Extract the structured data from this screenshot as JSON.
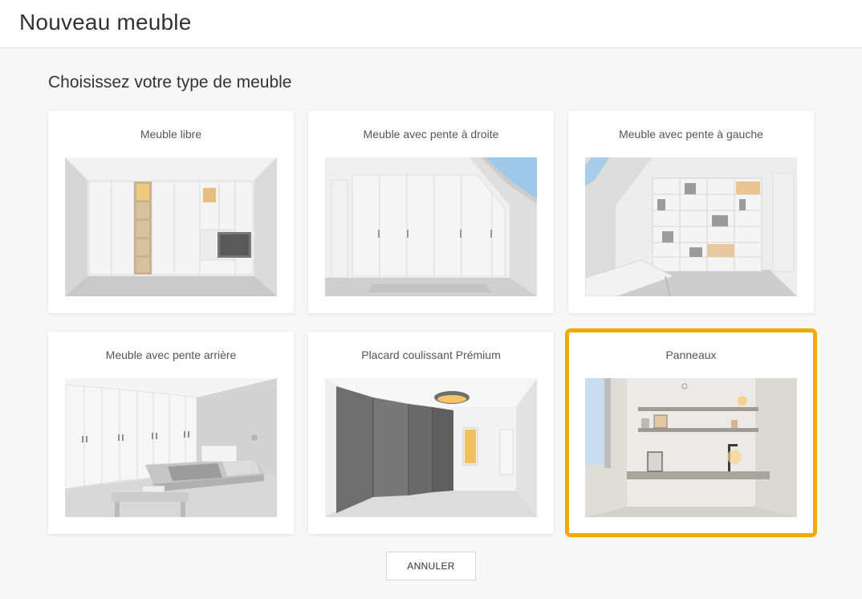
{
  "header": {
    "title": "Nouveau meuble"
  },
  "main": {
    "subtitle": "Choisissez votre type de meuble",
    "cards": [
      {
        "label": "Meuble libre",
        "selected": false
      },
      {
        "label": "Meuble avec pente à droite",
        "selected": false
      },
      {
        "label": "Meuble avec pente à gauche",
        "selected": false
      },
      {
        "label": "Meuble avec pente arrière",
        "selected": false
      },
      {
        "label": "Placard coulissant Prémium",
        "selected": false
      },
      {
        "label": "Panneaux",
        "selected": true
      }
    ]
  },
  "footer": {
    "cancel_label": "ANNULER"
  },
  "colors": {
    "accent": "#f5a800",
    "background": "#f7f7f7",
    "card": "#ffffff"
  }
}
